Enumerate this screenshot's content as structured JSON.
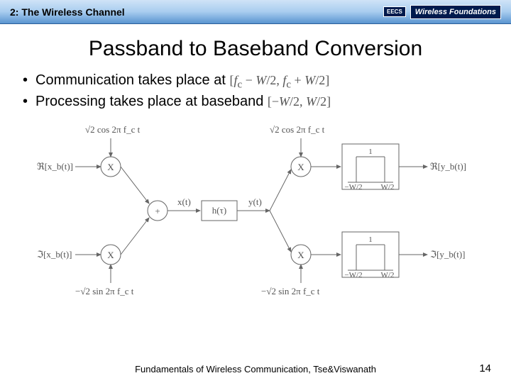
{
  "header": {
    "chapter": "2: The Wireless Channel",
    "logo_eecs": "EECS",
    "logo_wf": "Wireless Foundations"
  },
  "title": "Passband to Baseband Conversion",
  "bullets": [
    {
      "text": "Communication takes place at",
      "math": "[f_c − W/2, f_c + W/2]"
    },
    {
      "text": "Processing takes place at baseband",
      "math": "[−W/2, W/2]"
    }
  ],
  "diagram": {
    "tx_cos": "√2 cos 2π f_c t",
    "tx_neg_sin": "−√2 sin 2π f_c t",
    "rx_cos": "√2 cos 2π f_c t",
    "rx_neg_sin": "−√2 sin 2π f_c t",
    "in_real": "ℜ[x_b(t)]",
    "in_imag": "ℑ[x_b(t)]",
    "out_real": "ℜ[y_b(t)]",
    "out_imag": "ℑ[y_b(t)]",
    "sum_out": "x(t)",
    "chan_in": "y(t)",
    "channel": "h(τ)",
    "filter_gain": "1",
    "filter_neg": "−W/2",
    "filter_pos": "W/2",
    "mult": "X",
    "plus": "+"
  },
  "footer": {
    "text": "Fundamentals of Wireless Communication, Tse&Viswanath",
    "page": "14"
  }
}
